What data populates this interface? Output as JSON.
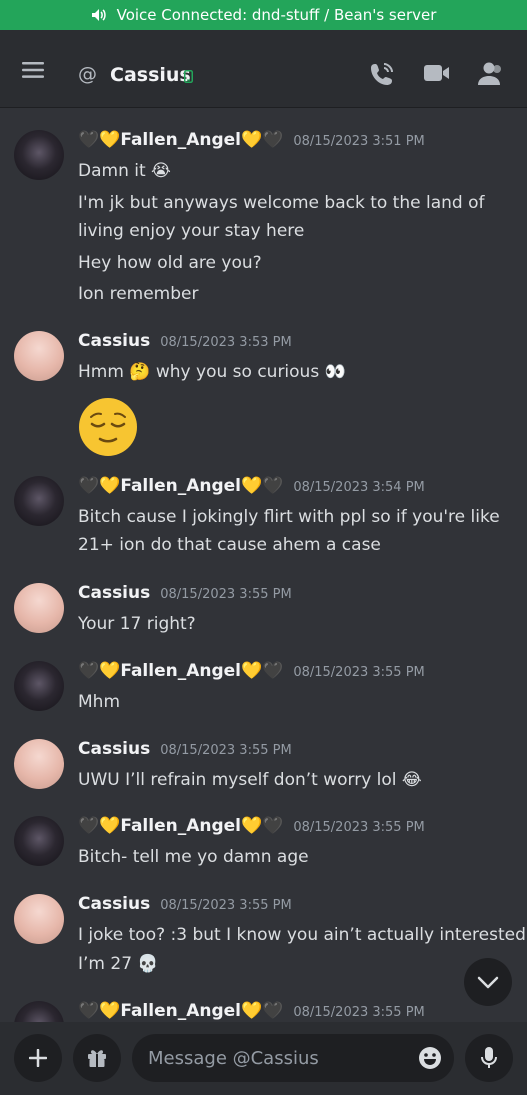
{
  "voice_banner": {
    "text": "Voice Connected: dnd-stuff / Bean's server",
    "icon": "speaker-icon"
  },
  "header": {
    "at_symbol": "@",
    "title": "Cassius",
    "icons": [
      "menu-icon",
      "mobile-status-icon",
      "voice-call-icon",
      "video-call-icon",
      "members-icon"
    ]
  },
  "messages": [
    {
      "author": "🖤💛Fallen_Angel💛🖤",
      "time": "08/15/2023 3:51 PM",
      "lines": [
        "Damn it 😭",
        "I'm jk but anyways welcome back to the land of",
        "living enjoy your stay here",
        "Hey how old are you?",
        "Ion remember"
      ]
    },
    {
      "author": "Cassius",
      "time": "08/15/2023 3:53 PM",
      "lines": [
        "Hmm 🤔 why you so curious 👀"
      ],
      "big_emoji": "😌"
    },
    {
      "author": "🖤💛Fallen_Angel💛🖤",
      "time": "08/15/2023 3:54 PM",
      "lines": [
        "Bitch cause I jokingly flirt with ppl so if you're like",
        "21+ ion do that cause ahem a case"
      ]
    },
    {
      "author": "Cassius",
      "time": "08/15/2023 3:55 PM",
      "lines": [
        "Your 17 right?"
      ]
    },
    {
      "author": "🖤💛Fallen_Angel💛🖤",
      "time": "08/15/2023 3:55 PM",
      "lines": [
        "Mhm"
      ]
    },
    {
      "author": "Cassius",
      "time": "08/15/2023 3:55 PM",
      "lines": [
        "UWU I’ll refrain myself don’t worry lol 😂"
      ]
    },
    {
      "author": "🖤💛Fallen_Angel💛🖤",
      "time": "08/15/2023 3:55 PM",
      "lines": [
        "Bitch- tell me yo damn age"
      ]
    },
    {
      "author": "Cassius",
      "time": "08/15/2023 3:55 PM",
      "lines": [
        "I joke too? :3 but I know you ain’t actually interested",
        "I’m 27 💀"
      ]
    },
    {
      "author": "🖤💛Fallen_Angel💛🖤",
      "time": "08/15/2023 3:55 PM",
      "lines": []
    }
  ],
  "composer": {
    "placeholder": "Message @Cassius"
  },
  "colors": {
    "banner": "#23a55a",
    "background": "#313338",
    "header": "#2b2d31",
    "input": "#1e1f22"
  }
}
